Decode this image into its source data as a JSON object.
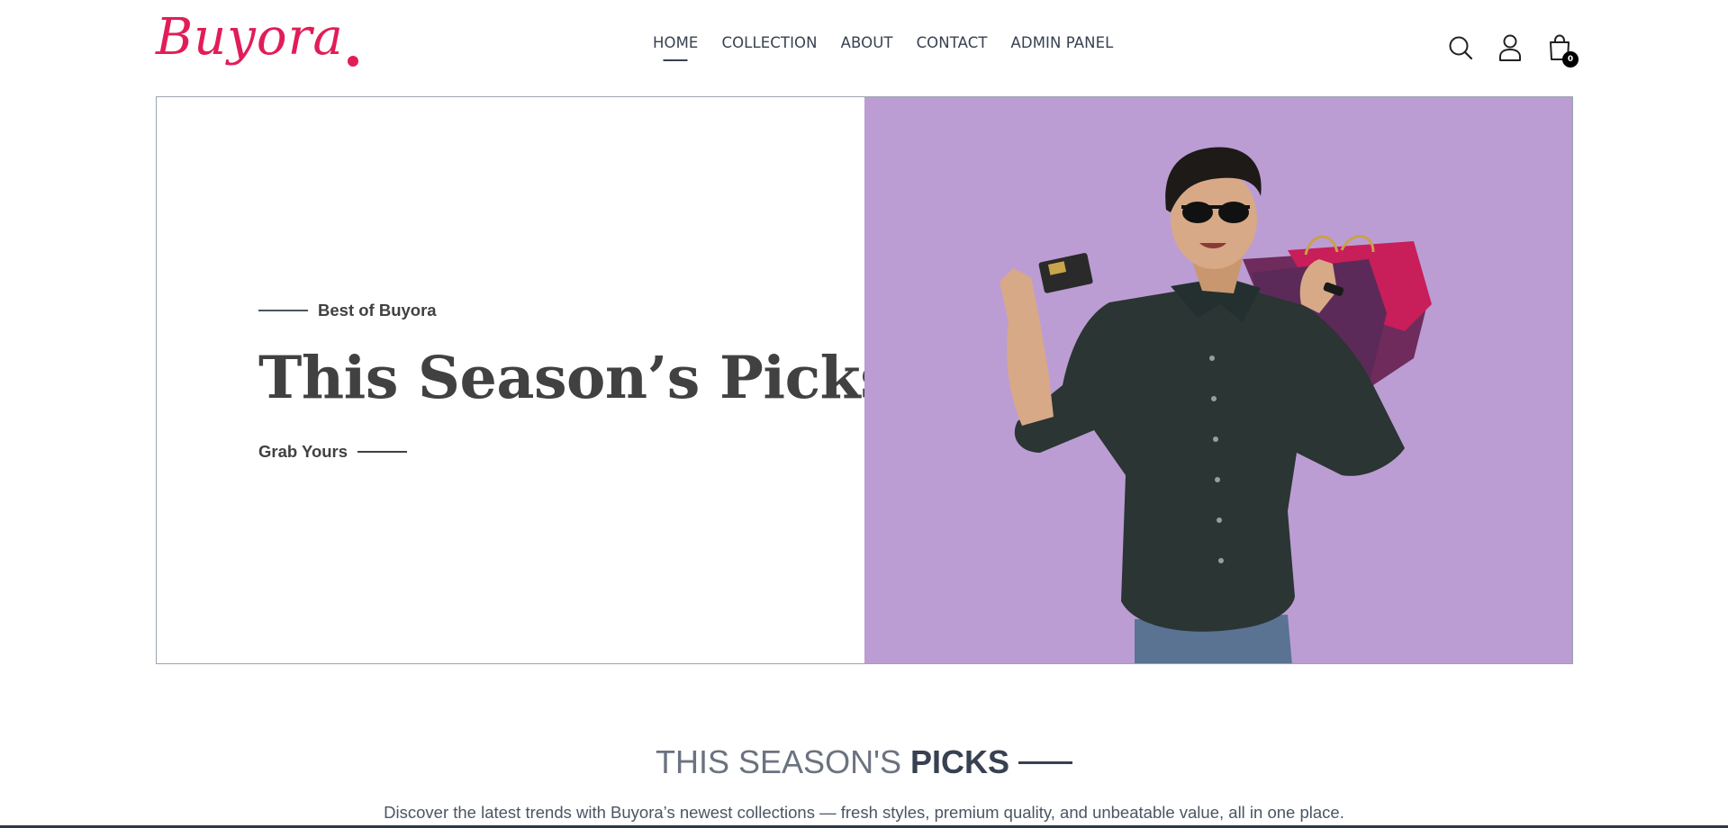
{
  "brand": {
    "name": "Buyora",
    "color": "#e11d58"
  },
  "nav": {
    "items": [
      {
        "label": "HOME",
        "active": true
      },
      {
        "label": "COLLECTION",
        "active": false
      },
      {
        "label": "ABOUT",
        "active": false
      },
      {
        "label": "CONTACT",
        "active": false
      },
      {
        "label": "ADMIN PANEL",
        "active": false
      }
    ]
  },
  "header_icons": [
    "search-icon",
    "user-icon",
    "cart-icon"
  ],
  "cart": {
    "count": "0"
  },
  "hero": {
    "eyebrow": "Best of Buyora",
    "title": "This Season’s Picks",
    "cta": "Grab Yours",
    "image_bg": "#bb9dd3"
  },
  "section": {
    "title_light": "THIS SEASON'S",
    "title_bold": "PICKS",
    "description": "Discover the latest trends with Buyora’s newest collections — fresh styles, premium quality, and unbeatable value, all in one place."
  }
}
